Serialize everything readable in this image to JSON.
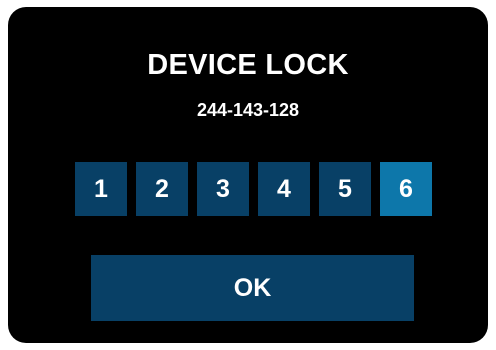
{
  "lock": {
    "title": "DEVICE LOCK",
    "code": "244-143-128"
  },
  "keypad": {
    "keys": [
      "1",
      "2",
      "3",
      "4",
      "5",
      "6"
    ],
    "active_key": "6"
  },
  "ok_label": "OK",
  "colors": {
    "panel_bg": "#000000",
    "key_bg": "#084066",
    "key_active_bg": "#0d77aa",
    "text": "#ffffff"
  }
}
